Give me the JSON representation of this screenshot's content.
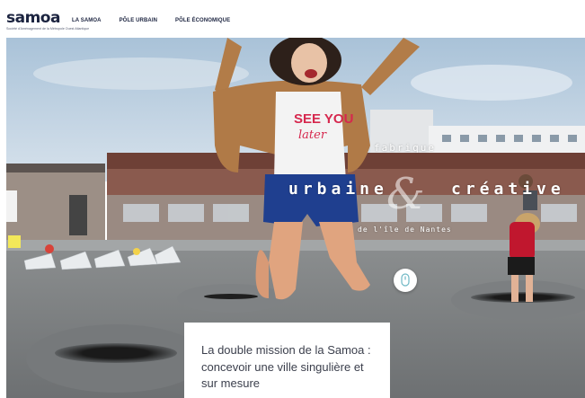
{
  "brand": {
    "logo_text": "samoa",
    "logo_subtext": "Société d'Aménagement de la Métropole Ouest Atlantique"
  },
  "nav": {
    "items": [
      {
        "label": "LA SAMOA"
      },
      {
        "label": "PÔLE URBAIN"
      },
      {
        "label": "PÔLE ÉCONOMIQUE"
      }
    ]
  },
  "hero": {
    "tagline_1": "fabrique",
    "tagline_2": "urbaine",
    "tagline_amp": "&",
    "tagline_3": "créative",
    "tagline_4": "de l'île de Nantes",
    "shirt_text_1": "SEE YOU",
    "shirt_text_2": "later"
  },
  "mission": {
    "text": "La double mission de la Samoa : concevoir une ville singulière et sur mesure"
  },
  "colors": {
    "brand_navy": "#1c2440",
    "header_bg": "#ffffff",
    "accent_teal": "#6fb8c5"
  },
  "icons": {
    "scroll": "scroll-down-mouse-icon"
  }
}
